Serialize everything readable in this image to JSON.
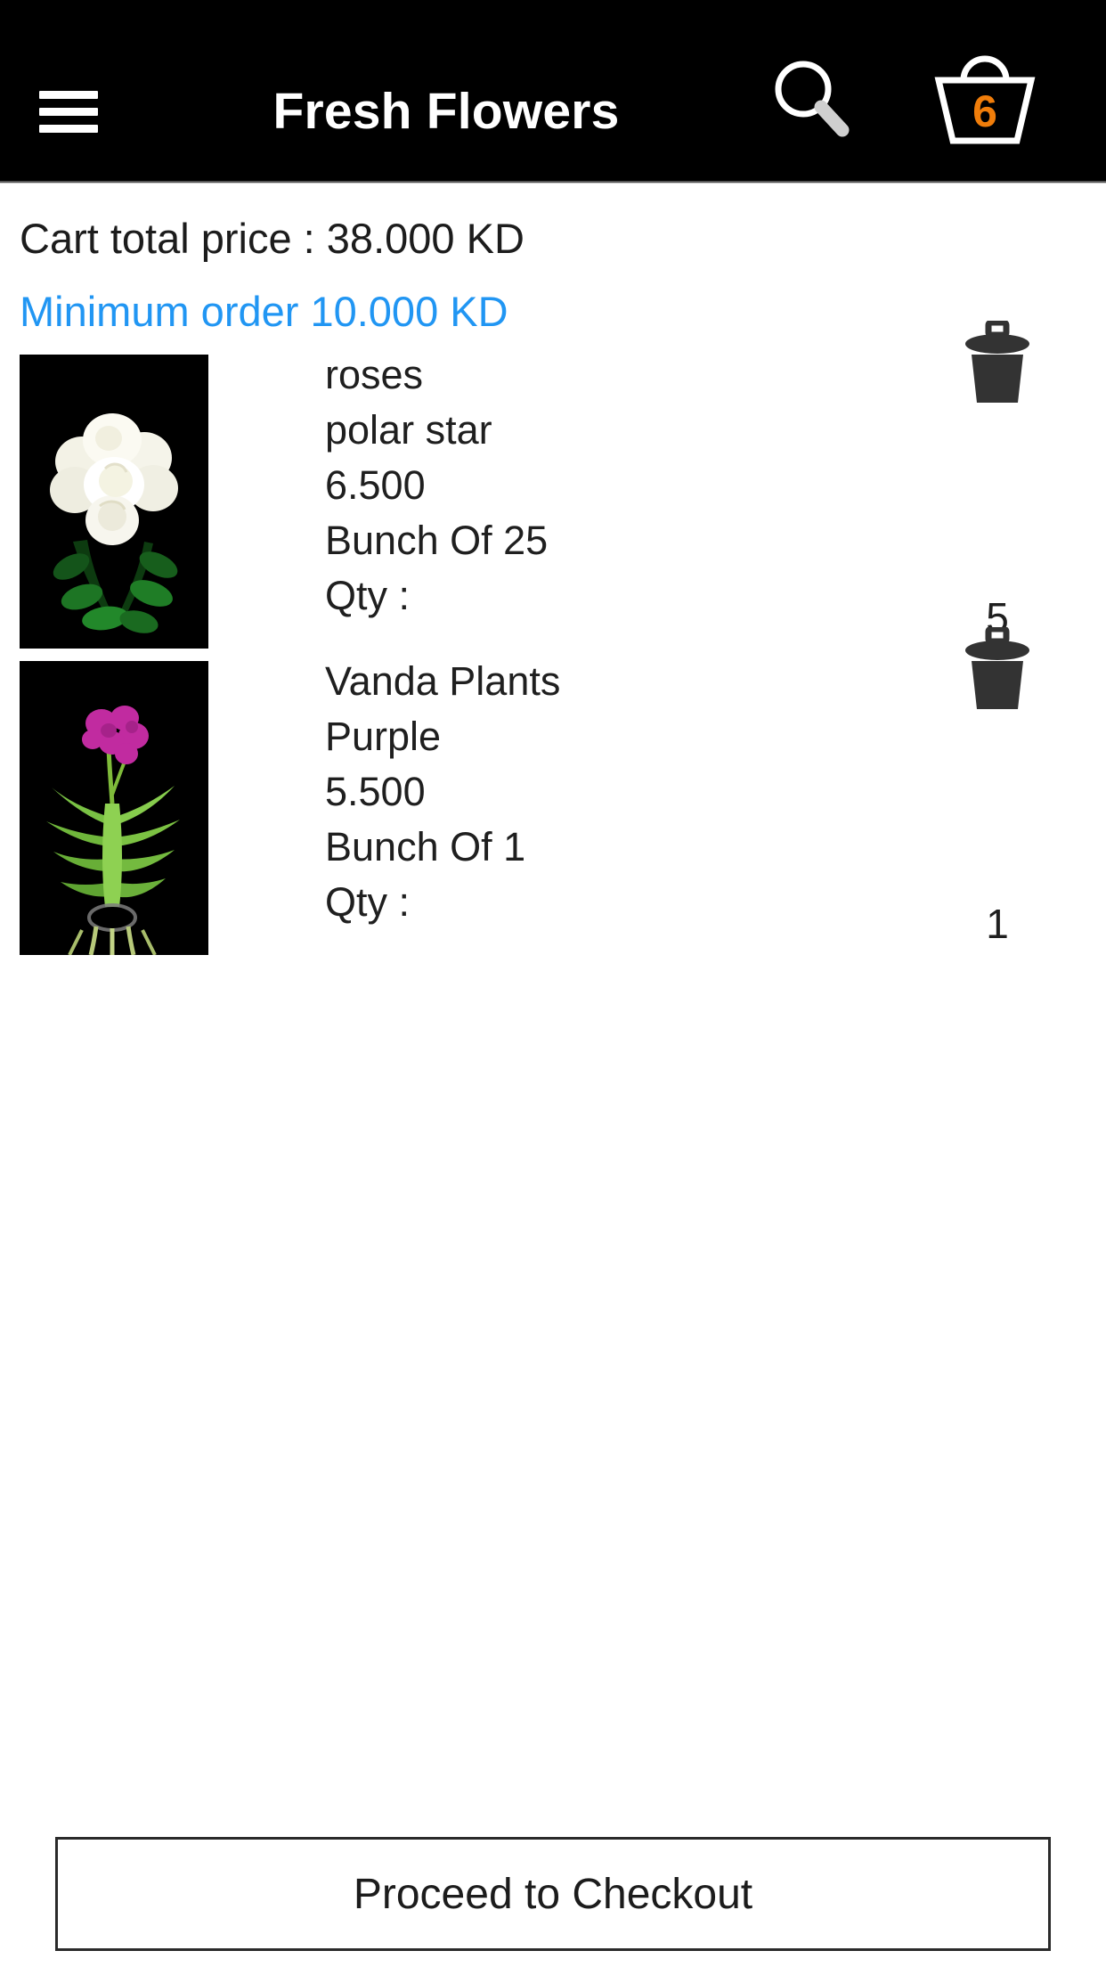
{
  "header": {
    "title": "Fresh Flowers",
    "menu_icon": "hamburger-menu-icon",
    "search_icon": "search-icon",
    "cart_icon": "shopping-basket-icon",
    "cart_count": "6",
    "background_color": "#000000",
    "cart_count_color": "#f07d0a"
  },
  "summary": {
    "cart_total_label": "Cart total price : 38.000 KD",
    "minimum_order_label": "Minimum order 10.000 KD",
    "minimum_order_color": "#2196f3"
  },
  "cart": {
    "items": [
      {
        "name": "roses",
        "variety": "polar star",
        "price": "6.500",
        "bunch": "Bunch Of 25",
        "qty_label": "Qty :",
        "qty_value": "5",
        "delete_icon": "trash-icon",
        "image_alt": "white-roses-bouquet"
      },
      {
        "name": "Vanda Plants",
        "variety": "Purple",
        "price": "5.500",
        "bunch": "Bunch Of 1",
        "qty_label": "Qty :",
        "qty_value": "1",
        "delete_icon": "trash-icon",
        "image_alt": "purple-vanda-orchid-plant"
      }
    ]
  },
  "footer": {
    "checkout_label": "Proceed to Checkout"
  }
}
